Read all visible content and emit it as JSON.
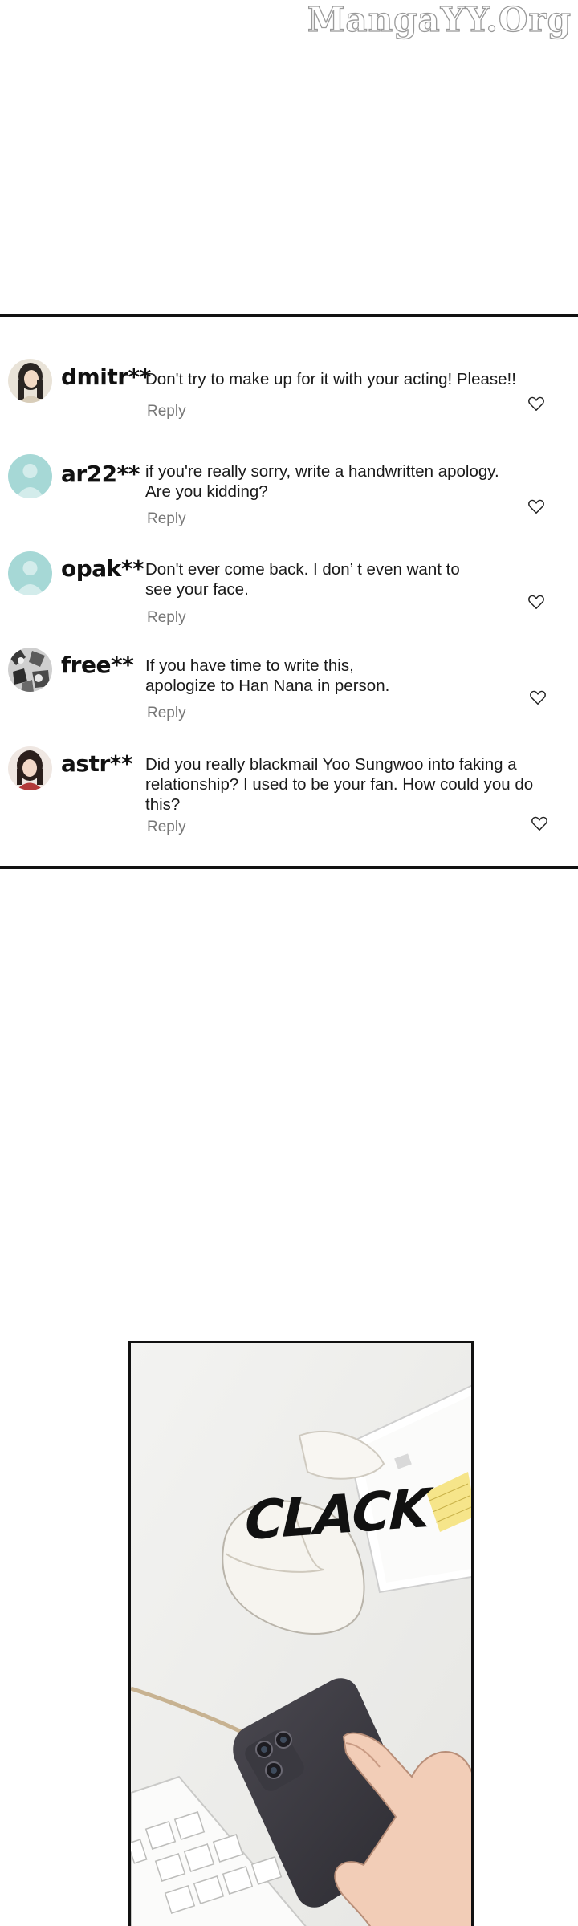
{
  "watermark": "MangaYY.Org",
  "comments": [
    {
      "user": "dmitr**",
      "text_lines": [
        "Don't try to make up for it with your acting! Please!!"
      ],
      "reply": "Reply",
      "avatar": "woman-avatar"
    },
    {
      "user": "ar22**",
      "text_lines": [
        "if you're really sorry, write a handwritten apology.",
        "Are you kidding?"
      ],
      "reply": "Reply",
      "avatar": "default-avatar"
    },
    {
      "user": "opak**",
      "text_lines": [
        "Don't ever come back. I don’ t even want to",
        "see your face."
      ],
      "reply": "Reply",
      "avatar": "default-avatar"
    },
    {
      "user": "free**",
      "text_lines": [
        "If you have time to write this,",
        "apologize to Han Nana in person."
      ],
      "reply": "Reply",
      "avatar": "pattern-avatar"
    },
    {
      "user": "astr**",
      "text_lines": [
        "Did you really blackmail Yoo Sungwoo into faking a",
        "relationship? I used to be your fan. How could you do this?"
      ],
      "reply": "Reply",
      "avatar": "woman-avatar"
    }
  ],
  "panel": {
    "sfx": "CLACK"
  },
  "colors": {
    "avatar_default": "#a6d8d6",
    "reply": "#777777",
    "border": "#111111"
  }
}
